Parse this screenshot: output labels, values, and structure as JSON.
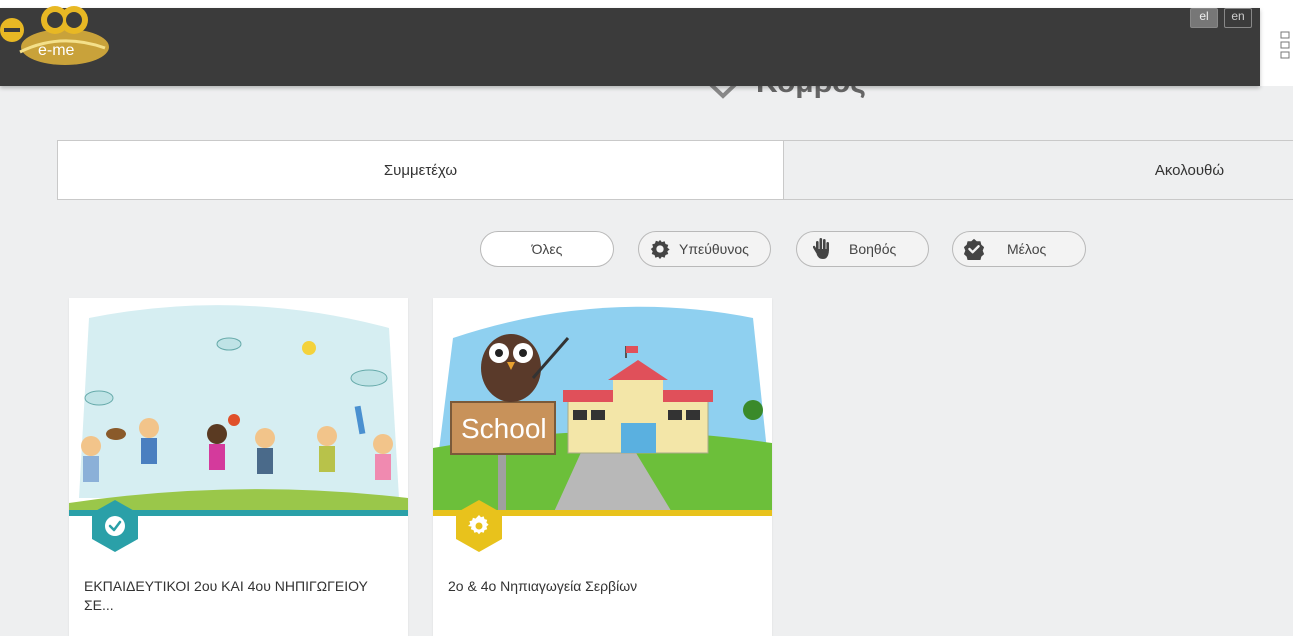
{
  "header": {
    "logo_text": "e-me",
    "languages": [
      {
        "label": "el",
        "active": true
      },
      {
        "label": "en",
        "active": false
      }
    ]
  },
  "page": {
    "title": "Κόμβος"
  },
  "tabs": [
    {
      "label": "Συμμετέχω",
      "active": true
    },
    {
      "label": "Ακολουθώ",
      "active": false
    }
  ],
  "filters": {
    "all": "Όλες",
    "owner": "Υπεύθυνος",
    "helper": "Βοηθός",
    "member": "Μέλος"
  },
  "cards": [
    {
      "title": "ΕΚΠΑΙΔΕΥΤΙΚΟΙ 2ου ΚΑΙ 4ου ΝΗΠΙΓΩΓΕΙΟΥ ΣΕ...",
      "role_icon": "check-badge-icon",
      "color": "#2aa0a8"
    },
    {
      "title": "2ο & 4ο Νηπιαγωγεία Σερβίων",
      "role_icon": "gear-badge-icon",
      "color": "#e8c21c",
      "sign_text": "School"
    }
  ]
}
